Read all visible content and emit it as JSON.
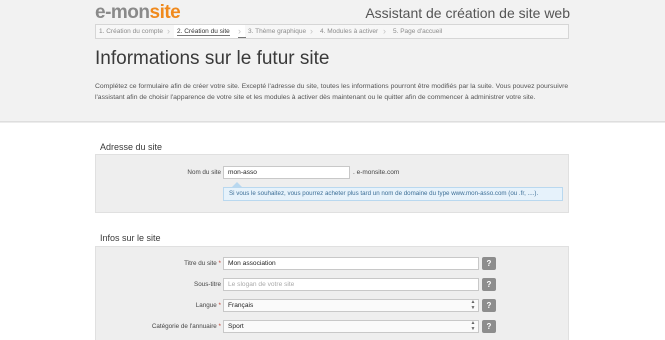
{
  "header": {
    "logo_prefix": "e-mon",
    "logo_accent": "site",
    "assistant_title": "Assistant de création de site web"
  },
  "steps": [
    {
      "label": "1.  Création du compte",
      "active": false
    },
    {
      "label": "2.  Création du site",
      "active": true
    },
    {
      "label": "3.  Thème graphique",
      "active": false
    },
    {
      "label": "4.  Modules à activer",
      "active": false
    },
    {
      "label": "5.  Page d'accueil",
      "active": false
    }
  ],
  "page": {
    "title": "Informations sur le futur site",
    "intro": "Complétez ce formulaire afin de créer votre site. Excepté l'adresse du site, toutes les informations pourront être modifiés par la suite. Vous pouvez poursuivre l'assistant afin de choisir l'apparence de votre site et les modules à activer dès maintenant ou le quitter afin de commencer à administrer votre site."
  },
  "address_section": {
    "title": "Adresse du site",
    "site_name_label": "Nom du site",
    "site_name_value": "mon-asso",
    "suffix": ". e-monsite.com",
    "hint": "Si vous le souhaitez, vous pourrez acheter plus tard un nom de domaine du type www.mon-asso.com (ou .fr, ....)."
  },
  "infos_section": {
    "title": "Infos sur le site",
    "title_label": "Titre du site",
    "title_value": "Mon association",
    "subtitle_label": "Sous-titre",
    "subtitle_placeholder": "Le slogan de votre site",
    "language_label": "Langue",
    "language_value": "Français",
    "category_label": "Catégorie de l'annuaire",
    "category_value": "Sport",
    "required_mark": "*",
    "help_symbol": "?"
  },
  "colors": {
    "accent": "#f08a1d",
    "hint_bg": "#e6f2fb"
  }
}
